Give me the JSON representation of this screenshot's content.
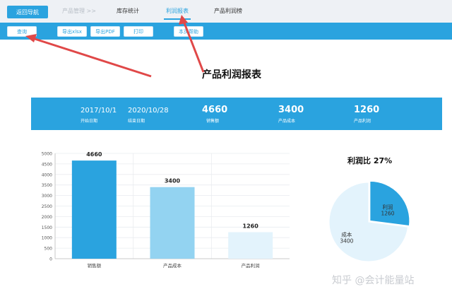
{
  "nav": {
    "home": "返回导航",
    "items": [
      "产品管理 >>",
      "库存统计",
      "利润报表",
      "产品利润榜"
    ]
  },
  "toolbar": {
    "query": "查询",
    "export_xlsx": "导出xlsx",
    "export_pdf": "导出PDF",
    "print": "打印",
    "help": "本页帮助"
  },
  "report": {
    "title": "产品利润报表"
  },
  "summary": {
    "start_date": "2017/10/1",
    "start_label": "开始日期",
    "end_date": "2020/10/28",
    "end_label": "结束日期",
    "sales": "4660",
    "sales_label": "销售额",
    "cost": "3400",
    "cost_label": "产品成本",
    "profit": "1260",
    "profit_label": "产品利润"
  },
  "chart_data": [
    {
      "type": "bar",
      "categories": [
        "销售额",
        "产品成本",
        "产品利润"
      ],
      "values": [
        4660,
        3400,
        1260
      ],
      "ylim": [
        0,
        5000
      ],
      "yticks": [
        "0",
        "500",
        "1000",
        "1500",
        "2000",
        "2500",
        "3000",
        "3500",
        "4000",
        "4500",
        "5000"
      ],
      "colors": [
        "#2aa3df",
        "#93d3f1",
        "#e3f3fc"
      ],
      "title": "",
      "xlabel": "",
      "ylabel": "",
      "grid": true
    },
    {
      "type": "pie",
      "title": "利润比 27%",
      "slices": [
        {
          "label": "利润",
          "value": 1260,
          "color": "#2aa3df"
        },
        {
          "label": "成本",
          "value": 3400,
          "color": "#e3f3fc"
        }
      ]
    }
  ],
  "watermark": "知乎 @会计能量站",
  "colors": {
    "accent": "#2aa3df",
    "arrow": "#e04848"
  }
}
